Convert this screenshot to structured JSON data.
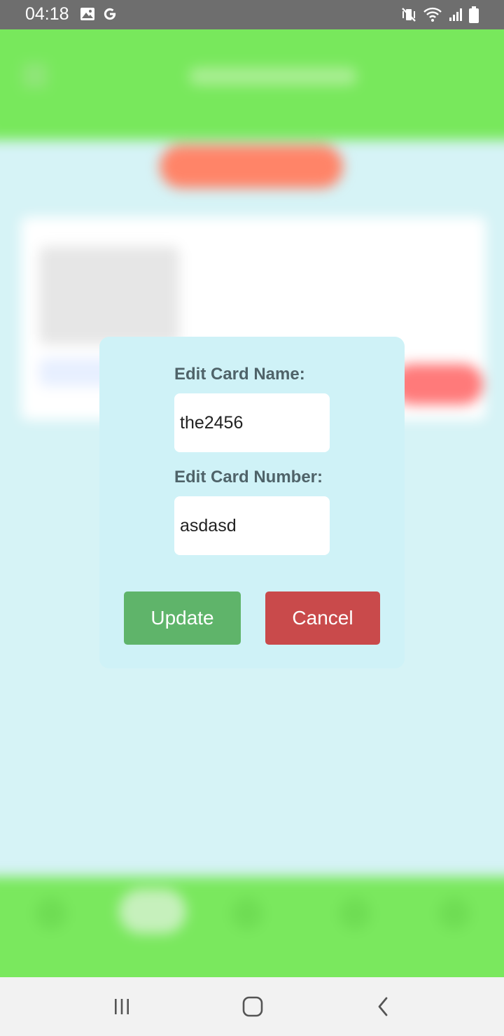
{
  "status_bar": {
    "time": "04:18",
    "left_icons": [
      "image-icon",
      "google-g-icon"
    ],
    "right_icons": [
      "mute-vibrate-icon",
      "wifi-icon",
      "signal-icon",
      "battery-icon"
    ]
  },
  "modal": {
    "card_name_label": "Edit Card Name:",
    "card_name_value": "the2456",
    "card_number_label": "Edit Card Number:",
    "card_number_value": "asdasd",
    "update_label": "Update",
    "cancel_label": "Cancel"
  },
  "system_nav": {
    "buttons": [
      "recent-apps-icon",
      "home-icon",
      "back-icon"
    ]
  },
  "colors": {
    "header_green": "#78e85c",
    "modal_bg": "#cff2f7",
    "update_green": "#5fb46a",
    "cancel_red": "#c94a4b",
    "status_bar": "#6e6e6e"
  }
}
